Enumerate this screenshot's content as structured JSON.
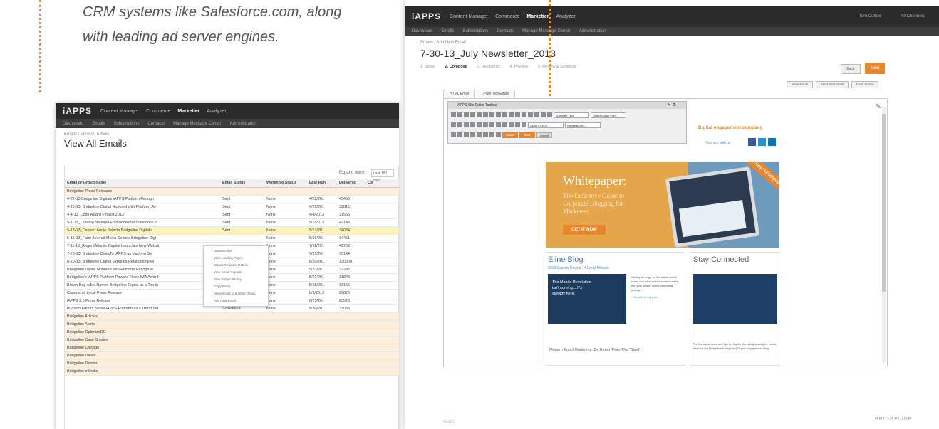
{
  "caption": {
    "line1": "CRM systems like Salesforce.com, along",
    "line2": "with leading ad server engines."
  },
  "colors": {
    "accent": "#e8862e",
    "topbar": "#2b2b2b",
    "subbar": "#3d3d3d"
  },
  "left": {
    "logo": "iAPPS",
    "nav": [
      "Content Manager",
      "Commerce",
      "Marketier",
      "Analyzer"
    ],
    "active_nav": "Marketier",
    "subnav": [
      "Dashboard",
      "Emails",
      "Subscriptions",
      "Contacts",
      "Manage Message Center",
      "Administration"
    ],
    "breadcrumb": "Emails / View All Emails",
    "title": "View All Emails",
    "expand_label": "Expand within:",
    "expand_value": "Last 180 days",
    "columns": [
      "Email or Group Name",
      "Email Status",
      "Workflow Status",
      "Last Run",
      "Delivered",
      "Op"
    ],
    "rows": [
      {
        "name": "Bridgeline Press Releases",
        "status": "",
        "workflow": "",
        "last": "",
        "delivered": "",
        "type": "group"
      },
      {
        "name": "4-22-13 Bridgeline Digitals iAPPS Platform Recogn",
        "status": "Sent",
        "workflow": "None",
        "last": "4/22/201",
        "delivered": "45453",
        "type": "row"
      },
      {
        "name": "4-25-13_Bridgeline Digital Honored with Platform Re",
        "status": "Sent",
        "workflow": "None",
        "last": "4/25/201",
        "delivered": "32815",
        "type": "row"
      },
      {
        "name": "4-4-13_Code Award Finalist 2013",
        "status": "Sent",
        "workflow": "None",
        "last": "4/4/2013",
        "delivered": "31556",
        "type": "row"
      },
      {
        "name": "5-1-13_Leading National Environmental Solutions Co",
        "status": "Sent",
        "workflow": "None",
        "last": "5/1/2013",
        "delivered": "42143",
        "type": "row"
      },
      {
        "name": "5-13-13_Canyon Audio Selects Bridgeline Digital's",
        "status": "Sent",
        "workflow": "None",
        "last": "5/13/201",
        "delivered": "34034",
        "type": "highlight"
      },
      {
        "name": "5-16-13_Farm Journal Media Selects Bridgeline Digi",
        "status": "",
        "workflow": "None",
        "last": "5/16/201",
        "delivered": "34451",
        "type": "row"
      },
      {
        "name": "7-11-13_RegentAtlantic Capital Launches New Websit",
        "status": "",
        "workflow": "None",
        "last": "7/11/201",
        "delivered": "42753",
        "type": "row"
      },
      {
        "name": "7-25-13_Bridgeline Digital's iAPPS as platform Sel",
        "status": "",
        "workflow": "None",
        "last": "7/25/201",
        "delivered": "35144",
        "type": "row"
      },
      {
        "name": "8-20-13_Bridgeline Digital Expands Relationship wi",
        "status": "",
        "workflow": "None",
        "last": "8/20/201",
        "delivered": "130800",
        "type": "row"
      },
      {
        "name": "Bridgeline Digital Honored with Platform Recogn w",
        "status": "",
        "workflow": "None",
        "last": "5/23/201",
        "delivered": "32235",
        "type": "row"
      },
      {
        "name": "Bridgeline's iAPPS Platform Powers Three IMA Award",
        "status": "",
        "workflow": "None",
        "last": "5/21/201",
        "delivered": "31843",
        "type": "row"
      },
      {
        "name": "Brown Bag Adds Names Bridgeline Digital as a Top In",
        "status": "",
        "workflow": "None",
        "last": "5/15/201",
        "delivered": "33155",
        "type": "row"
      },
      {
        "name": "Comments Local Press Release",
        "status": "Scheduled",
        "workflow": "None",
        "last": "8/1/2013",
        "delivered": "29826",
        "type": "row"
      },
      {
        "name": "iAPPS 2.5 Press Release",
        "status": "Sent",
        "workflow": "None",
        "last": "6/25/201",
        "delivered": "63323",
        "type": "row"
      },
      {
        "name": "InVision Editors Name iAPPS Platform as a Trend Set",
        "status": "Scheduled",
        "workflow": "None",
        "last": "8/30/201",
        "delivered": "33036",
        "type": "row"
      },
      {
        "name": "Bridgeline Articles",
        "status": "",
        "workflow": "",
        "last": "",
        "delivered": "",
        "type": "group"
      },
      {
        "name": "Bridgeline Alerts",
        "status": "",
        "workflow": "",
        "last": "",
        "delivered": "",
        "type": "group"
      },
      {
        "name": "Bridgeline OptimizeDC",
        "status": "",
        "workflow": "",
        "last": "",
        "delivered": "",
        "type": "group"
      },
      {
        "name": "Bridgeline Case Studies",
        "status": "",
        "workflow": "",
        "last": "",
        "delivered": "",
        "type": "group"
      },
      {
        "name": "Bridgeline Chicago",
        "status": "",
        "workflow": "",
        "last": "",
        "delivered": "",
        "type": "group"
      },
      {
        "name": "Bridgeline Dallas",
        "status": "",
        "workflow": "",
        "last": "",
        "delivered": "",
        "type": "group"
      },
      {
        "name": "Bridgeline Denver",
        "status": "",
        "workflow": "",
        "last": "",
        "delivered": "",
        "type": "group"
      },
      {
        "name": "Bridgeline eBooks",
        "status": "",
        "workflow": "",
        "last": "",
        "delivered": "",
        "type": "group"
      }
    ],
    "context_menu": [
      "Unsubscribe",
      "View Landing Pages",
      "Export Recipient Details",
      "View Email Reports",
      "View Subject/Notify",
      "Copy Email",
      "Move Email to another Group",
      "Add New Email"
    ]
  },
  "right": {
    "logo": "iAPPS",
    "nav": [
      "Content Manager",
      "Commerce",
      "Marketier",
      "Analyzer"
    ],
    "active_nav": "Marketier",
    "user": "Tom Cuffee",
    "site": "All Channels",
    "subnav": [
      "Dashboard",
      "Emails",
      "Subscriptions",
      "Contacts",
      "Manage Message Center",
      "Administration"
    ],
    "breadcrumb": "Emails / Add New Email",
    "title": "7-30-13_July Newsletter_2013",
    "steps": [
      "1. Setup",
      "2. Compose",
      "3. Recipients",
      "4. Preview",
      "5. Review & Schedule"
    ],
    "active_step": "2. Compose",
    "back": "Back",
    "next": "Next",
    "tools": [
      "Save Email",
      "Send Test Email",
      "Draft Status"
    ],
    "tabs": [
      "HTML Email",
      "Plain Text Email"
    ],
    "toolbar_title": "iAPPS Site Editor Toolbar",
    "toolbar_selects": [
      "Translate Text",
      "Select Image Path",
      "Apply CSS Cl...",
      "Paragraph St..."
    ],
    "toolbar_buttons": [
      "Source",
      "Save",
      "Cancel"
    ],
    "engagement_heading": "Digital engagement company",
    "connect_text": "Connect with us",
    "whitepaper": {
      "heading": "Whitepaper:",
      "sub": "The Definitive Guide to Corporate Blogging for Marketers",
      "cta": "GET IT NOW",
      "ribbon": "New Whitepaper!"
    },
    "blog": {
      "heading": "Eline Blog",
      "link": "2013 Experts Reveal 14 Email Mistake",
      "image_text": "The Mobile Revolution isn't coming... It's already here.",
      "body": "Gaining an edge on the latest mobile trends and what makes smaller users with your Mobile digital marketing strategy.",
      "read_more": "» Read this blog post",
      "bottom": "Modern Email Marketing: Be Better Than The \"Blast\""
    },
    "stay": {
      "heading": "Stay Connected",
      "body": "For the latest news and tips on Digital Marketing strategies, check back for our Bridgeline's blogs and Digital Engagement Blog."
    },
    "footer_left": "©2013",
    "footer_right": "BRIDGELINE"
  }
}
